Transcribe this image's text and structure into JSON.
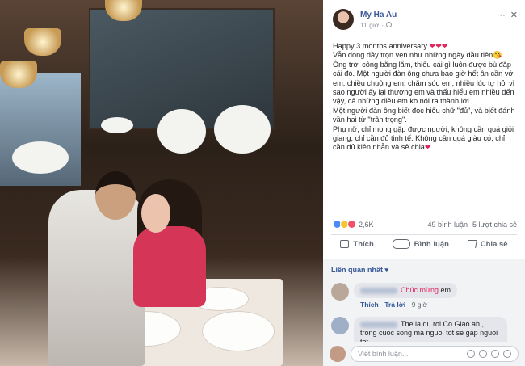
{
  "post": {
    "author": "My Ha Au",
    "time": "11 giờ",
    "privacy_icon": "globe-icon",
    "text_lines": [
      "Happy 3 months anniversary",
      "Vẫn đong đầy trọn vẹn như những ngày đầu tiên",
      "Ông trời công bằng lắm, thiếu cái gì luôn được bù đắp cái đó. Một người đàn ông chưa bao giờ hết ân cần với em, chiều chuộng em, chăm sóc em, nhiều lúc tự hỏi vì sao người ấy lại thương em và thấu hiểu em nhiều đến vậy, cả những điều em ko nói ra thành lời.",
      "Một người đàn ông biết đọc hiểu chữ \"đủ\", và biết đánh vần hai từ \"trân trọng\".",
      "Phụ nữ, chỉ mong gặp được người, không cần quá giỏi giang, chỉ cần đủ tinh tế. Không cần quá giàu có, chỉ cần đủ kiên nhẫn và sẻ chia"
    ],
    "heart_emoji": "❤❤❤",
    "end_heart": "❤",
    "smile_emoji": "😘"
  },
  "stats": {
    "reaction_count": "2,6K",
    "comments": "49 bình luận",
    "shares": "5 lượt chia sẻ"
  },
  "actions": {
    "like": "Thích",
    "comment": "Bình luận",
    "share": "Chia sẻ"
  },
  "comments_section": {
    "sort_label": "Liên quan nhất ▾",
    "comments": [
      {
        "text_highlight": "Chúc mừng",
        "text": " em",
        "like": "Thích",
        "reply": "Trả lời",
        "time": "9 giờ"
      },
      {
        "text": "The la du roi Co Giao ah , trong cuoc song ma nguoi tot se gap nguoi tot"
      }
    ],
    "write_placeholder": "Viết bình luận..."
  }
}
